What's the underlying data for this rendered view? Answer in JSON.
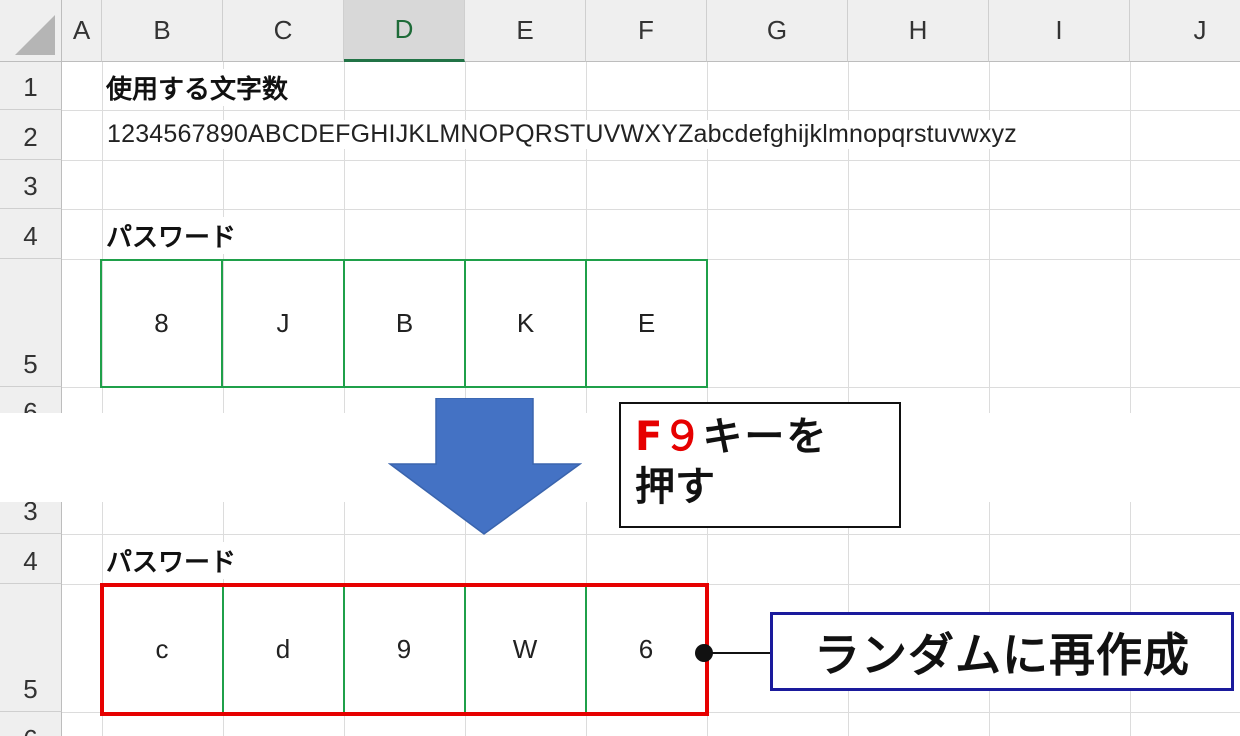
{
  "columns": [
    "A",
    "B",
    "C",
    "D",
    "E",
    "F",
    "G",
    "H",
    "I",
    "J"
  ],
  "top_rows": [
    "1",
    "2",
    "3",
    "4",
    "5",
    "6"
  ],
  "bottom_rows": [
    "3",
    "4",
    "5",
    "6"
  ],
  "cells": {
    "label_chars": "使用する文字数",
    "char_list": "1234567890ABCDEFGHIJKLMNOPQRSTUVWXYZabcdefghijklmnopqrstuvwxyz",
    "label_password_top": "パスワード",
    "label_password_bottom": "パスワード"
  },
  "password_before": [
    "8",
    "J",
    "B",
    "K",
    "E"
  ],
  "password_after": [
    "c",
    "d",
    "9",
    "W",
    "6"
  ],
  "callout_f9": {
    "key": "F９",
    "text1": "キーを",
    "text2": "押す"
  },
  "callout_regen": "ランダムに再作成",
  "colors": {
    "arrow": "#4472c4",
    "green_border": "#1fa04a",
    "red_border": "#e60000",
    "callout_blue_border": "#1a1a9c",
    "key_red": "#e60000"
  }
}
